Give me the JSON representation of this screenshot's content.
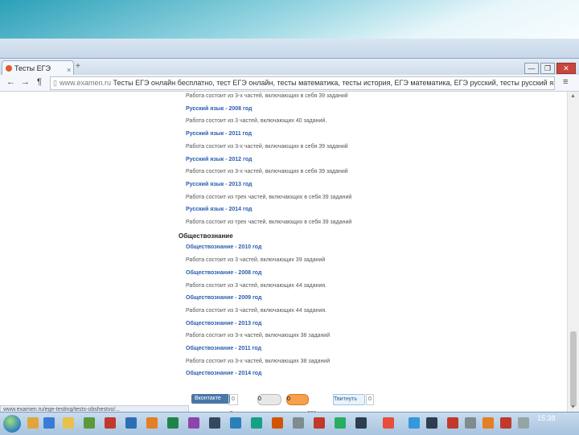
{
  "browser": {
    "tab_title": "Тесты ЕГЭ онлайн",
    "tab_close": "×",
    "new_tab": "+",
    "nav_back": "←",
    "nav_forward": "→",
    "nav_reader": "¶",
    "address_host": "www.examen.ru",
    "address_title": "Тесты ЕГЭ онлайн бесплатно, тест ЕГЭ онлайн, тесты математика, тесты история, ЕГЭ математика, ЕГЭ русский, тесты русский язык",
    "menu": "≡",
    "window_buttons": [
      "—",
      "❐",
      "✕"
    ]
  },
  "content": {
    "lines": [
      {
        "kind": "desc",
        "text": "Работа состоит из 3-х частей, включающих в себя 39 заданий"
      },
      {
        "kind": "link",
        "text": "Русский язык - 2008 год"
      },
      {
        "kind": "desc",
        "text": "Работа состоит из 3 частей, включающих 40 заданий."
      },
      {
        "kind": "link",
        "text": "Русский язык - 2011 год"
      },
      {
        "kind": "desc",
        "text": "Работа состоит из 3-х частей, включающих в себя 39 заданий"
      },
      {
        "kind": "link",
        "text": "Русский язык - 2012 год"
      },
      {
        "kind": "desc",
        "text": "Работа состоит из 3-х частей, включающих в себя 39 заданий"
      },
      {
        "kind": "link",
        "text": "Русский язык - 2013 год"
      },
      {
        "kind": "desc",
        "text": "Работа состоит из трех частей, включающих в себя 39 заданий"
      },
      {
        "kind": "link",
        "text": "Русский язык - 2014 год"
      },
      {
        "kind": "desc",
        "text": "Работа состоит из трех частей, включающих в себя 39 заданий"
      },
      {
        "kind": "section",
        "text": "Обществознание"
      },
      {
        "kind": "link",
        "text": "Обществознание - 2010 год"
      },
      {
        "kind": "desc",
        "text": "Работа состоит из 3 частей, включающих 39 заданий"
      },
      {
        "kind": "link",
        "text": "Обществознание - 2008 год"
      },
      {
        "kind": "desc",
        "text": "Работа состоит из 3 частей, включающих 44 задания."
      },
      {
        "kind": "link",
        "text": "Обществознание - 2009 год"
      },
      {
        "kind": "desc",
        "text": "Работа состоит из 3 частей, включающих 44 задания."
      },
      {
        "kind": "link",
        "text": "Обществознание - 2013 год"
      },
      {
        "kind": "desc",
        "text": "Работа состоит из 3-х частей, включающих 38 заданий"
      },
      {
        "kind": "link",
        "text": "Обществознание - 2011 год"
      },
      {
        "kind": "desc",
        "text": "Работа состоит из 3-х частей, включающих 38 заданий"
      },
      {
        "kind": "link",
        "text": "Обществознание - 2014 год"
      }
    ],
    "social": {
      "vk_label": "Вконтакте",
      "vk_count": "0",
      "ok1_label": "0",
      "ok2_label": "0",
      "twitter_label": "Твитнуть",
      "twitter_count": "0"
    },
    "pager_left": "5",
    "pager_right": "221"
  },
  "status_url": "www.examen.ru/ege-testing/tests-obshestvo/...",
  "taskbar": {
    "time": "15:38"
  },
  "colors": {
    "link": "#2a5db0",
    "section": "#222222",
    "desc": "#555555"
  }
}
